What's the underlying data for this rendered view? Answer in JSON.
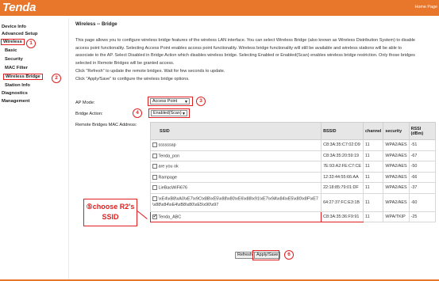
{
  "header": {
    "logo": "Tenda",
    "home_link": "Home Page"
  },
  "sidebar": {
    "items": [
      {
        "label": "Device Info"
      },
      {
        "label": "Advanced Setup"
      },
      {
        "label": "Wireless"
      },
      {
        "label": "Basic"
      },
      {
        "label": "Security"
      },
      {
        "label": "MAC Filter"
      },
      {
        "label": "Wireless Bridge"
      },
      {
        "label": "Station Info"
      },
      {
        "label": "Diagnostics"
      },
      {
        "label": "Management"
      }
    ]
  },
  "main": {
    "title": "Wireless -- Bridge",
    "desc_1": "This page allows you to configure wireless bridge features of the wireless LAN interface. You can select Wireless Bridge (also known as Wireless Distribution System) to disable",
    "desc_2": "access point functionality. Selecting Access Point enables access point functionality. Wireless bridge functionality will still be available and wireless stations will be able to",
    "desc_3": "associate to the AP. Select Disabled in Bridge Action which disables wireless bridge. Selecting Enabled or Enabled(Scan) enables wireless bridge restriction. Only those bridges",
    "desc_4": "selected in Remote Bridges will be granted access.",
    "desc_5": "Click \"Refresh\" to update the remote bridges. Wait for few seconds to update.",
    "desc_6": "Click \"Apply/Save\" to configure the wireless bridge options.",
    "ap_mode_label": "AP Mode:",
    "ap_mode_value": "Access Point",
    "bridge_action_label": "Bridge Action:",
    "bridge_action_value": "Enabled(Scan)",
    "remote_label": "Remote Bridges MAC Address:",
    "refresh_button": "Refresh",
    "apply_button": "Apply/Save"
  },
  "table": {
    "headers": {
      "ssid": "SSID",
      "bssid": "BSSID",
      "channel": "channel",
      "security": "security",
      "rssi": "RSSI (dBm)"
    },
    "rows": [
      {
        "ssid": "ssssssap",
        "bssid": "C8:3A:35:C7:02:D9",
        "channel": "11",
        "security": "WPA2/AES",
        "rssi": "-51",
        "checked": false
      },
      {
        "ssid": "Tenda_pon",
        "bssid": "C8:3A:35:20:59:19",
        "channel": "11",
        "security": "WPA2/AES",
        "rssi": "-67",
        "checked": false
      },
      {
        "ssid": "are you ok",
        "bssid": "7E:93:A2:FE:C7:CE",
        "channel": "11",
        "security": "WPA2/AES",
        "rssi": "-50",
        "checked": false
      },
      {
        "ssid": "Rampage",
        "bssid": "12:33:44:55:66:AA",
        "channel": "11",
        "security": "WPA2/AES",
        "rssi": "-66",
        "checked": false
      },
      {
        "ssid": "LieBaoWiFi676",
        "bssid": "22:18:85:79:01:DF",
        "channel": "11",
        "security": "WPA2/AES",
        "rssi": "-37",
        "checked": false
      },
      {
        "ssid": "\\xE4\\xB8\\xA0\\xE7\\x9C\\x8B\\xE5\\x88\\x80\\xE6\\x88\\x91\\xE7\\x9A\\x84\\xE5\\x80\\x8F\\xE7\\x88\\x84\\xE4\\xB8\\x80\\xE5\\x90\\x97",
        "bssid": "64:27:37:FC:E3:1B",
        "channel": "11",
        "security": "WPA2/AES",
        "rssi": "-60",
        "checked": false,
        "tall": true
      },
      {
        "ssid": "Tenda_ABC",
        "bssid": "C8:3A:35:36:F9:91",
        "channel": "11",
        "security": "WPA/TKIP",
        "rssi": "-25",
        "checked": true
      }
    ]
  },
  "annotations": {
    "c1": "1",
    "c2": "2",
    "c3": "3",
    "c4": "4",
    "c6": "6",
    "note_line1": "⑤choose R2's",
    "note_line2": "SSID"
  },
  "colors": {
    "brand": "#e8762b",
    "annotation": "#e02020"
  }
}
